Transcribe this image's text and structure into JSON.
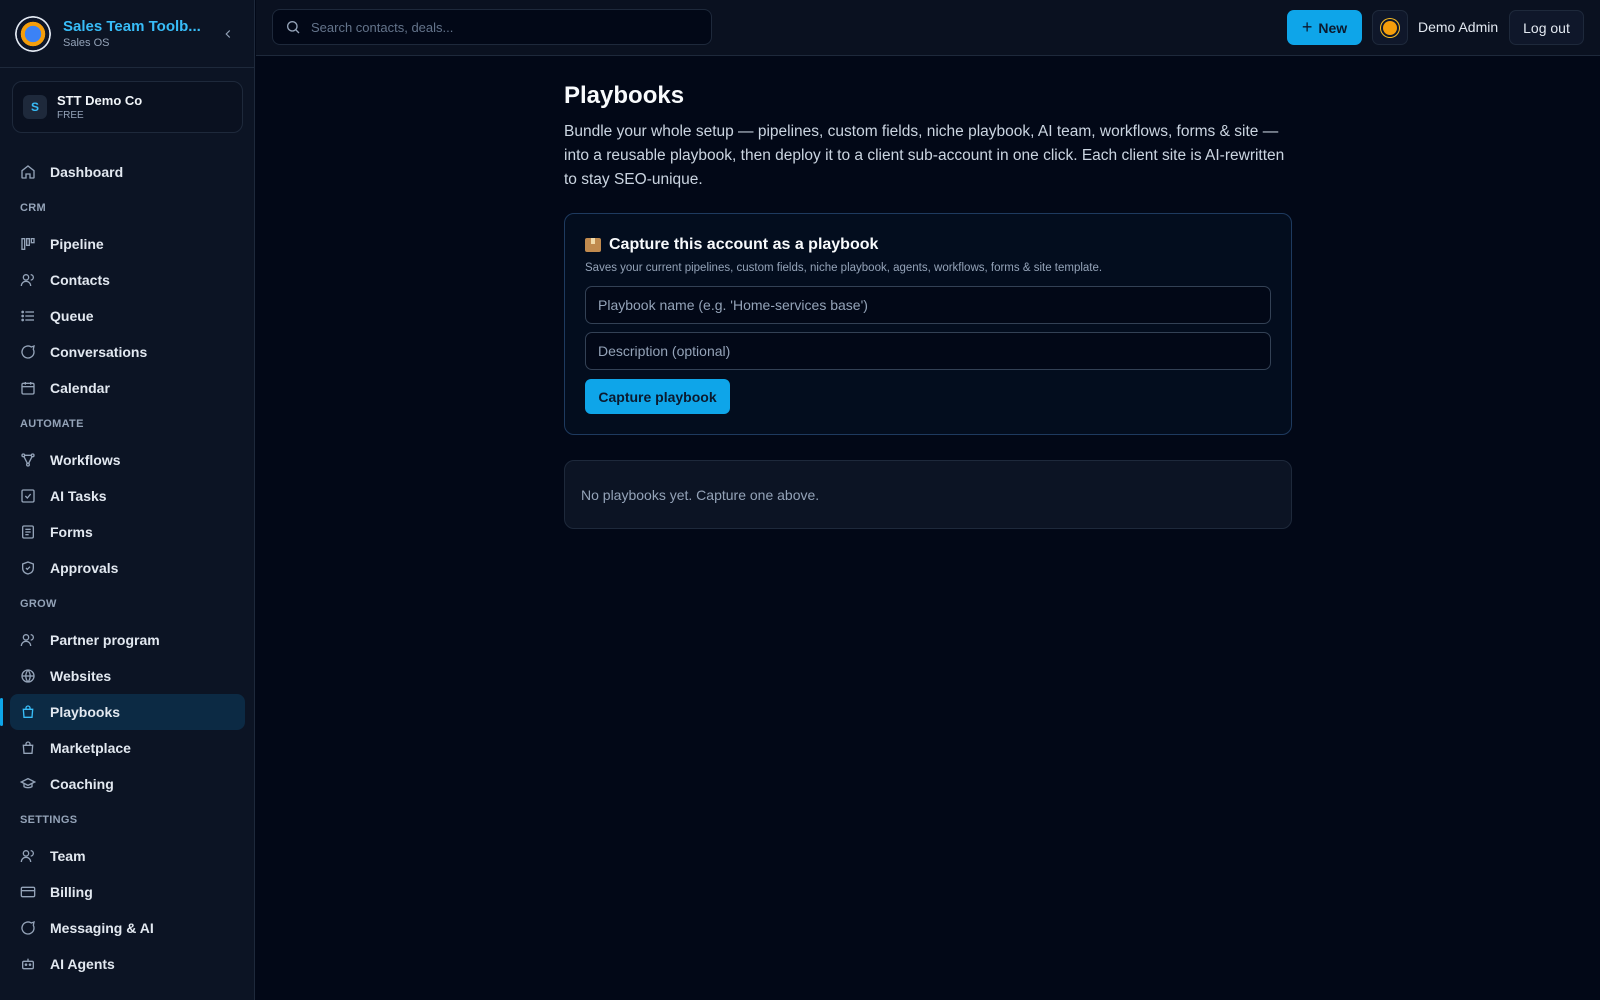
{
  "brand": {
    "title": "Sales Team Toolb...",
    "subtitle": "Sales OS"
  },
  "org": {
    "initial": "S",
    "name": "STT Demo Co",
    "plan": "FREE"
  },
  "nav": {
    "items": [
      {
        "label": "Dashboard"
      },
      {
        "section": "CRM"
      },
      {
        "label": "Pipeline"
      },
      {
        "label": "Contacts"
      },
      {
        "label": "Queue"
      },
      {
        "label": "Conversations"
      },
      {
        "label": "Calendar"
      },
      {
        "section": "AUTOMATE"
      },
      {
        "label": "Workflows"
      },
      {
        "label": "AI Tasks"
      },
      {
        "label": "Forms"
      },
      {
        "label": "Approvals"
      },
      {
        "section": "GROW"
      },
      {
        "label": "Partner program"
      },
      {
        "label": "Websites"
      },
      {
        "label": "Playbooks",
        "active": true
      },
      {
        "label": "Marketplace"
      },
      {
        "label": "Coaching"
      },
      {
        "section": "SETTINGS"
      },
      {
        "label": "Team"
      },
      {
        "label": "Billing"
      },
      {
        "label": "Messaging & AI"
      },
      {
        "label": "AI Agents"
      }
    ]
  },
  "topbar": {
    "search_placeholder": "Search contacts, deals...",
    "new_label": "New",
    "user_name": "Demo Admin",
    "logout_label": "Log out"
  },
  "main": {
    "title": "Playbooks",
    "description": "Bundle your whole setup — pipelines, custom fields, niche playbook, AI team, workflows, forms & site — into a reusable playbook, then deploy it to a client sub-account in one click. Each client site is AI-rewritten to stay SEO-unique.",
    "capture": {
      "title": "Capture this account as a playbook",
      "subtitle": "Saves your current pipelines, custom fields, niche playbook, agents, workflows, forms & site template.",
      "name_placeholder": "Playbook name (e.g. 'Home-services base')",
      "description_placeholder": "Description (optional)",
      "button_label": "Capture playbook"
    },
    "empty_text": "No playbooks yet. Capture one above."
  },
  "colors": {
    "accent": "#0ea5e9",
    "background": "#020817",
    "sidebar": "#0c1424"
  }
}
